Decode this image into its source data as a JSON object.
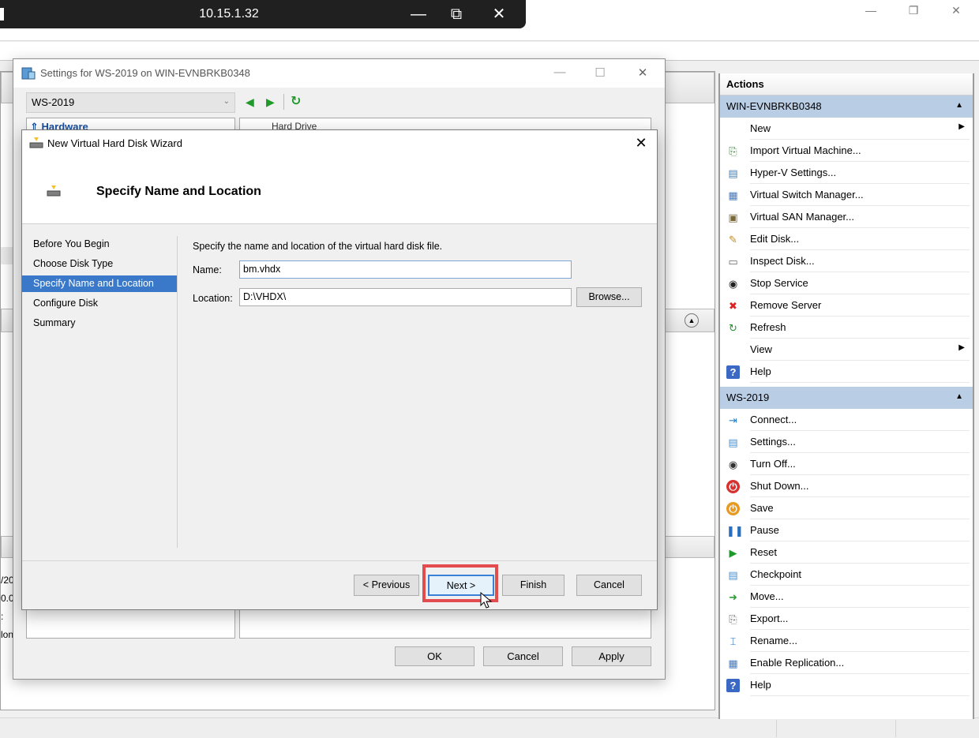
{
  "rdp": {
    "title": "10.15.1.32",
    "minimize": "—",
    "restore": "⧉",
    "close": "✕"
  },
  "host": {
    "minimize": "—",
    "restore": "❐",
    "close": "✕"
  },
  "background_left": {
    "lines": [
      "/20",
      "0.0",
      ":",
      "lon"
    ]
  },
  "actions": {
    "title": "Actions",
    "section1": {
      "header": "WIN-EVNBRKB0348",
      "items": [
        {
          "label": "New",
          "icon": "none",
          "submenu": true
        },
        {
          "label": "Import Virtual Machine...",
          "icon": "import-icon"
        },
        {
          "label": "Hyper-V Settings...",
          "icon": "settings-doc-icon"
        },
        {
          "label": "Virtual Switch Manager...",
          "icon": "switch-icon"
        },
        {
          "label": "Virtual SAN Manager...",
          "icon": "san-icon"
        },
        {
          "label": "Edit Disk...",
          "icon": "edit-disk-icon"
        },
        {
          "label": "Inspect Disk...",
          "icon": "inspect-disk-icon"
        },
        {
          "label": "Stop Service",
          "icon": "stop-icon"
        },
        {
          "label": "Remove Server",
          "icon": "remove-icon"
        },
        {
          "label": "Refresh",
          "icon": "refresh-icon"
        },
        {
          "label": "View",
          "icon": "none",
          "submenu": true
        },
        {
          "label": "Help",
          "icon": "help-icon"
        }
      ]
    },
    "section2": {
      "header": "WS-2019",
      "items": [
        {
          "label": "Connect...",
          "icon": "connect-icon"
        },
        {
          "label": "Settings...",
          "icon": "settings-icon"
        },
        {
          "label": "Turn Off...",
          "icon": "turn-off-icon"
        },
        {
          "label": "Shut Down...",
          "icon": "shut-down-icon"
        },
        {
          "label": "Save",
          "icon": "save-icon"
        },
        {
          "label": "Pause",
          "icon": "pause-icon"
        },
        {
          "label": "Reset",
          "icon": "reset-icon"
        },
        {
          "label": "Checkpoint",
          "icon": "checkpoint-icon"
        },
        {
          "label": "Move...",
          "icon": "move-icon"
        },
        {
          "label": "Export...",
          "icon": "export-icon"
        },
        {
          "label": "Rename...",
          "icon": "rename-icon"
        },
        {
          "label": "Enable Replication...",
          "icon": "replication-icon"
        },
        {
          "label": "Help",
          "icon": "help-icon"
        }
      ]
    }
  },
  "settings": {
    "title": "Settings for WS-2019 on WIN-EVNBRKB0348",
    "vm_selected": "WS-2019",
    "tree_first": "Hardware",
    "right_first": "Hard Drive",
    "buttons": {
      "ok": "OK",
      "cancel": "Cancel",
      "apply": "Apply"
    }
  },
  "wizard": {
    "title": "New Virtual Hard Disk Wizard",
    "header_title": "Specify Name and Location",
    "steps": [
      "Before You Begin",
      "Choose Disk Type",
      "Specify Name and Location",
      "Configure Disk",
      "Summary"
    ],
    "active_step": 2,
    "instruction": "Specify the name and location of the virtual hard disk file.",
    "name_label": "Name:",
    "name_value": "bm.vhdx",
    "location_label": "Location:",
    "location_value": "D:\\VHDX\\",
    "browse": "Browse...",
    "buttons": {
      "previous": "< Previous",
      "next": "Next >",
      "finish": "Finish",
      "cancel": "Cancel"
    }
  },
  "colors": {
    "accent": "#3a79c9",
    "action_header": "#b9cde5",
    "highlight": "#e34b4f",
    "rdp_bar": "#202020"
  }
}
